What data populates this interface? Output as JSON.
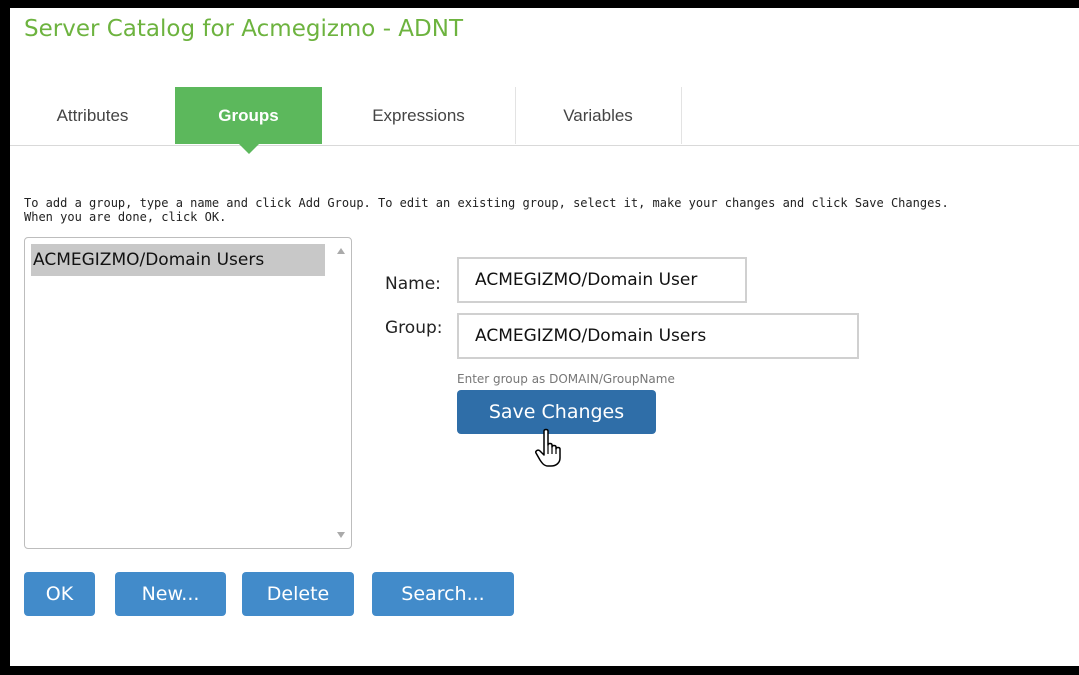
{
  "window": {
    "title": "Server Catalog for Acmegizmo - ADNT"
  },
  "tabs": [
    {
      "label": "Attributes",
      "active": false
    },
    {
      "label": "Groups",
      "active": true
    },
    {
      "label": "Expressions",
      "active": false
    },
    {
      "label": "Variables",
      "active": false
    }
  ],
  "instructions": {
    "line1": "To add a group, type a name and click Add Group. To edit an existing group, select it, make your changes and click Save Changes.",
    "line2": "When you are done, click OK."
  },
  "group_list": {
    "items": [
      "ACMEGIZMO/Domain Users"
    ],
    "selected_index": 0
  },
  "form": {
    "name_label": "Name:",
    "name_value": "ACMEGIZMO/Domain User",
    "group_label": "Group:",
    "group_value": "ACMEGIZMO/Domain Users",
    "group_hint": "Enter group as DOMAIN/GroupName",
    "save_label": "Save Changes"
  },
  "buttons": {
    "ok": "OK",
    "new": "New...",
    "delete": "Delete",
    "search": "Search..."
  },
  "colors": {
    "accent_green": "#5cb85c",
    "title_green": "#6db33f",
    "button_blue": "#428bca",
    "save_blue": "#2f6ea8"
  },
  "icons": {
    "cursor": "hand-pointer-icon"
  }
}
